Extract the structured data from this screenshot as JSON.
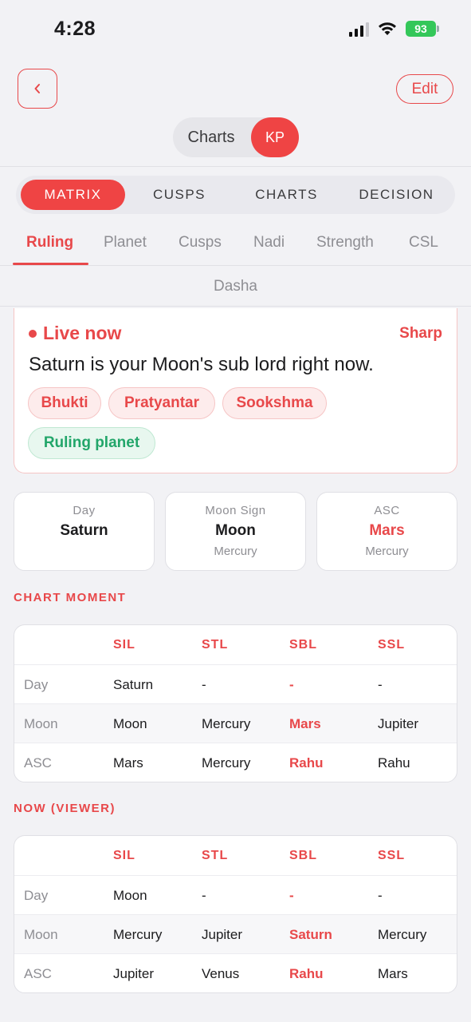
{
  "status": {
    "time": "4:28",
    "battery": "93"
  },
  "header": {
    "edit_label": "Edit"
  },
  "segment": {
    "charts": "Charts",
    "kp": "KP"
  },
  "main_tabs": [
    "MATRIX",
    "CUSPS",
    "CHARTS",
    "DECISION"
  ],
  "sub_tabs": [
    "Ruling",
    "Planet",
    "Cusps",
    "Nadi",
    "Strength",
    "CSL"
  ],
  "dasha_label": "Dasha",
  "live": {
    "title": "Live now",
    "sharp": "Sharp",
    "text": "Saturn is your Moon's sub lord right now.",
    "chips": [
      "Bhukti",
      "Pratyantar",
      "Sookshma"
    ],
    "green_chip": "Ruling planet"
  },
  "info_cards": [
    {
      "label": "Day",
      "value": "Saturn",
      "sub": ""
    },
    {
      "label": "Moon Sign",
      "value": "Moon",
      "sub": "Mercury"
    },
    {
      "label": "ASC",
      "value": "Mars",
      "sub": "Mercury"
    }
  ],
  "chart_moment": {
    "title": "CHART MOMENT",
    "headers": [
      "SIL",
      "STL",
      "SBL",
      "SSL"
    ],
    "rows": [
      {
        "label": "Day",
        "cells": [
          "Saturn",
          "-",
          "-",
          "-"
        ]
      },
      {
        "label": "Moon",
        "cells": [
          "Moon",
          "Mercury",
          "Mars",
          "Jupiter"
        ]
      },
      {
        "label": "ASC",
        "cells": [
          "Mars",
          "Mercury",
          "Rahu",
          "Rahu"
        ]
      }
    ]
  },
  "now_viewer": {
    "title": "NOW (VIEWER)",
    "headers": [
      "SIL",
      "STL",
      "SBL",
      "SSL"
    ],
    "rows": [
      {
        "label": "Day",
        "cells": [
          "Moon",
          "-",
          "-",
          "-"
        ]
      },
      {
        "label": "Moon",
        "cells": [
          "Mercury",
          "Jupiter",
          "Saturn",
          "Mercury"
        ]
      },
      {
        "label": "ASC",
        "cells": [
          "Jupiter",
          "Venus",
          "Rahu",
          "Mars"
        ]
      }
    ]
  },
  "colors": {
    "accent": "#ef4444",
    "green": "#22a66a",
    "background": "#f2f2f5"
  }
}
